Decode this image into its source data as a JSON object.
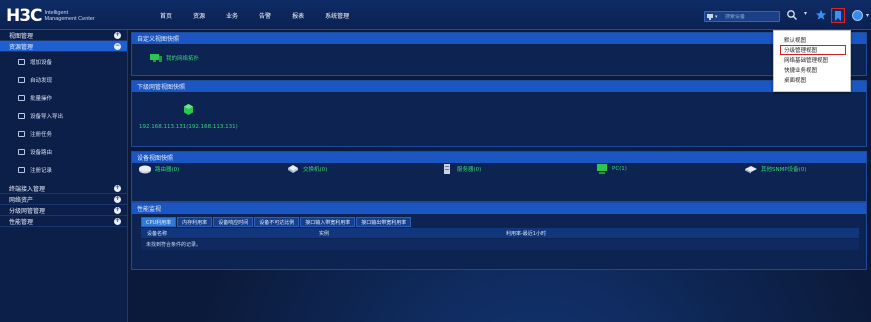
{
  "header": {
    "logo_main": "H3C",
    "logo_sub_line1": "Intelligent",
    "logo_sub_line2": "Management Center",
    "nav": [
      "首页",
      "资源",
      "业务",
      "告警",
      "报表",
      "系统管理"
    ],
    "search": {
      "placeholder": "搜索设备"
    },
    "icons": {
      "search": "search-icon",
      "star": "star-icon",
      "bookmark": "bookmark-icon",
      "user": "user-icon"
    }
  },
  "sidebar": {
    "sections": [
      {
        "label": "视图管理",
        "toggle": "+"
      },
      {
        "label": "资源管理",
        "toggle": "−"
      }
    ],
    "resource_items": [
      "增加设备",
      "自动发现",
      "批量操作",
      "设备导入导出",
      "注册任务",
      "设备路由",
      "注册记录"
    ],
    "bottom_sections": [
      {
        "label": "终端接入管理",
        "toggle": "+"
      },
      {
        "label": "网络资产",
        "toggle": "+"
      },
      {
        "label": "分级网管管理",
        "toggle": "+"
      },
      {
        "label": "性能管理",
        "toggle": "+"
      }
    ]
  },
  "main": {
    "custom_view": {
      "title": "自定义视图快照",
      "item": "我的网络拓扑"
    },
    "sub_view": {
      "title": "下级网管视图快照",
      "item": "192.168.113.131(192.168.113.131)"
    },
    "device_view": {
      "title": "设备视图快照",
      "items": [
        "路由器(0)",
        "交换机(0)",
        "服务器(0)",
        "PC(1)",
        "其他SNMP设备(0)"
      ]
    },
    "performance": {
      "title": "性能监视",
      "tabs": [
        "CPU利用率",
        "内存利用率",
        "设备响应时间",
        "设备不可达比例",
        "接口输入带宽利用率",
        "接口输出带宽利用率"
      ],
      "columns": [
        "设备名称",
        "实例",
        "利用率-最近1小时"
      ],
      "empty_text": "未找到符合条件的记录。"
    }
  },
  "dropdown": {
    "items": [
      "默认视图",
      "分级管理视图",
      "网络基础管理视图",
      "快捷业务视图",
      "桌面视图"
    ],
    "highlighted_index": 1
  },
  "colors": {
    "header_bg": "#0f2c66",
    "sidebar_active": "#1f5fcf",
    "panel_header": "#1b56c2",
    "link_green": "#38d47a",
    "highlight_red": "#d21e1e"
  }
}
